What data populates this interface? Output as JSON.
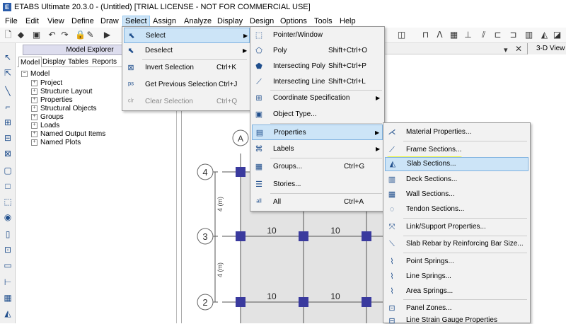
{
  "window": {
    "title": "ETABS Ultimate 20.3.0 - (Untitled)  [TRIAL LICENSE - NOT FOR COMMERCIAL USE]",
    "app_icon": "E"
  },
  "menubar": [
    "File",
    "Edit",
    "View",
    "Define",
    "Draw",
    "Select",
    "Assign",
    "Analyze",
    "Display",
    "Design",
    "Options",
    "Tools",
    "Help"
  ],
  "explorer": {
    "title": "Model Explorer",
    "tabs": [
      "Model",
      "Display",
      "Tables",
      "Reports"
    ],
    "root": "Model",
    "items": [
      "Project",
      "Structure Layout",
      "Properties",
      "Structural Objects",
      "Groups",
      "Loads",
      "Named Output Items",
      "Named Plots"
    ]
  },
  "view_tab": "3-D View",
  "select_menu": {
    "items": [
      {
        "label": "Select",
        "shortcut": "",
        "submenu": true
      },
      {
        "label": "Deselect",
        "shortcut": "",
        "submenu": true
      },
      {
        "label": "Invert Selection",
        "shortcut": "Ctrl+K"
      },
      {
        "label": "Get Previous Selection",
        "shortcut": "Ctrl+J"
      },
      {
        "label": "Clear Selection",
        "shortcut": "Ctrl+Q"
      }
    ]
  },
  "select_submenu": {
    "items": [
      {
        "label": "Pointer/Window",
        "shortcut": ""
      },
      {
        "label": "Poly",
        "shortcut": "Shift+Ctrl+O"
      },
      {
        "label": "Intersecting Poly",
        "shortcut": "Shift+Ctrl+P"
      },
      {
        "label": "Intersecting Line",
        "shortcut": "Shift+Ctrl+L"
      },
      {
        "label": "Coordinate Specification",
        "shortcut": ""
      },
      {
        "label": "Object Type...",
        "shortcut": ""
      },
      {
        "label": "Properties",
        "shortcut": ""
      },
      {
        "label": "Labels",
        "shortcut": ""
      },
      {
        "label": "Groups...",
        "shortcut": "Ctrl+G"
      },
      {
        "label": "Stories...",
        "shortcut": ""
      },
      {
        "label": "All",
        "shortcut": "Ctrl+A"
      }
    ]
  },
  "properties_submenu": {
    "items": [
      "Material Properties...",
      "Frame Sections...",
      "Slab Sections...",
      "Deck Sections...",
      "Wall Sections...",
      "Tendon Sections...",
      "Link/Support Properties...",
      "Slab Rebar by Reinforcing Bar Size...",
      "Point Springs...",
      "Line Springs...",
      "Area Springs...",
      "Panel Zones...",
      "Line Strain Gauge Properties"
    ]
  },
  "grid": {
    "bubbles": [
      "4",
      "3",
      "2",
      "A"
    ],
    "dim_labels": [
      "4 (m)",
      "4 (m)"
    ],
    "beam_labels": [
      "10",
      "10",
      "10",
      "10",
      "10",
      "10"
    ]
  },
  "colors": {
    "accent": "#cce4f7",
    "highlight": "#e8f70a",
    "joint": "#3a3a9e"
  }
}
